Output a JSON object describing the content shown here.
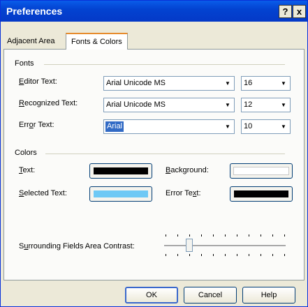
{
  "window": {
    "title": "Preferences",
    "help_label": "?",
    "close_label": "x"
  },
  "tabs": [
    {
      "label": "Adjacent Area",
      "active": false
    },
    {
      "label": "Fonts & Colors",
      "active": true
    }
  ],
  "fonts": {
    "heading": "Fonts",
    "rows": [
      {
        "label": "Editor Text:",
        "font": "Arial Unicode MS",
        "size": "16"
      },
      {
        "label": "Recognized Text:",
        "font": "Arial Unicode MS",
        "size": "12"
      },
      {
        "label": "Error Text:",
        "font": "Arial",
        "size": "10"
      }
    ]
  },
  "colors": {
    "heading": "Colors",
    "text_label": "Text:",
    "text_color": "#000000",
    "selected_text_label": "Selected Text:",
    "selected_text_color": "#6ec9f5",
    "background_label": "Background:",
    "background_color": "#ffffff",
    "error_text_label": "Error Text:",
    "error_text_color": "#000000"
  },
  "contrast": {
    "label": "Surrounding Fields Area Contrast:",
    "level": 0.2
  },
  "buttons": {
    "ok": "OK",
    "cancel": "Cancel",
    "help": "Help"
  }
}
